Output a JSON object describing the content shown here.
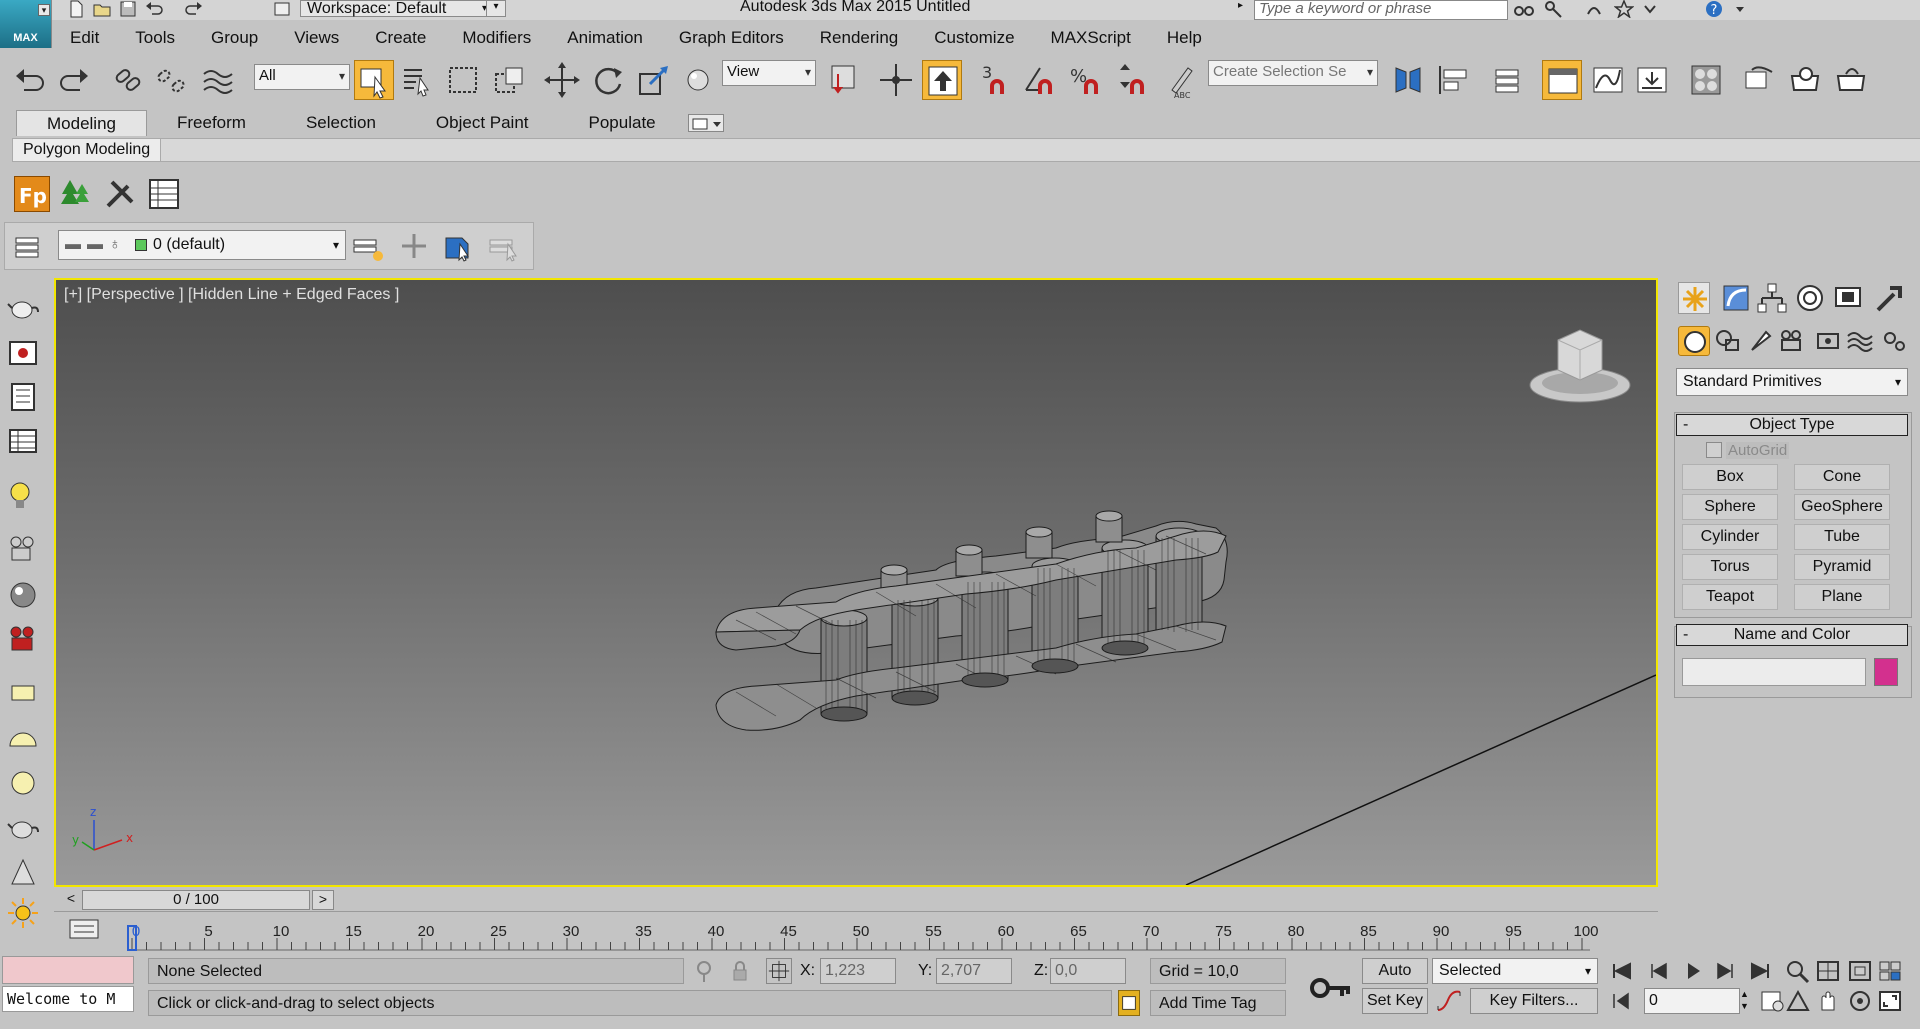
{
  "title_bar": {
    "workspace_label": "Workspace: Default",
    "app_title": "Autodesk 3ds Max  2015     Untitled",
    "search_placeholder": "Type a keyword or phrase",
    "logo_text": "MAX"
  },
  "menu": [
    "Edit",
    "Tools",
    "Group",
    "Views",
    "Create",
    "Modifiers",
    "Animation",
    "Graph Editors",
    "Rendering",
    "Customize",
    "MAXScript",
    "Help"
  ],
  "main_toolbar": {
    "selection_filter": "All",
    "ref_coord": "View",
    "snap_label": "3",
    "named_selection_placeholder": "Create Selection Se"
  },
  "ribbon": {
    "tabs": [
      "Modeling",
      "Freeform",
      "Selection",
      "Object Paint",
      "Populate"
    ],
    "active_tab": "Modeling",
    "panel_label": "Polygon Modeling"
  },
  "layer_bar": {
    "current_layer": "0 (default)"
  },
  "viewport": {
    "label": "[+] [Perspective ] [Hidden Line + Edged Faces ]",
    "border_color": "#f2e600",
    "axis": {
      "x": "x",
      "y": "y",
      "z": "z"
    }
  },
  "command_panel": {
    "primitive_type": "Standard Primitives",
    "object_type_title": "Object Type",
    "autogrid": "AutoGrid",
    "primitives": [
      "Box",
      "Cone",
      "Sphere",
      "GeoSphere",
      "Cylinder",
      "Tube",
      "Torus",
      "Pyramid",
      "Teapot",
      "Plane"
    ],
    "name_color_title": "Name and Color",
    "object_color": "#d3308e"
  },
  "time_slider": {
    "position": "0 / 100",
    "prev": "<",
    "next": ">"
  },
  "track_bar": {
    "ticks": [
      "0",
      "5",
      "10",
      "15",
      "20",
      "25",
      "30",
      "35",
      "40",
      "45",
      "50",
      "55",
      "60",
      "65",
      "70",
      "75",
      "80",
      "85",
      "90",
      "95",
      "100"
    ]
  },
  "status_bar": {
    "maxscript_listener": "Welcome to M",
    "selection_status": "None Selected",
    "prompt": "Click or click-and-drag to select objects",
    "x_label": "X:",
    "x_value": "1,223",
    "y_label": "Y:",
    "y_value": "2,707",
    "z_label": "Z:",
    "z_value": "0,0",
    "grid": "Grid = 10,0",
    "add_time_tag": "Add Time Tag",
    "auto_key": "Auto Key",
    "set_key": "Set Key",
    "key_mode": "Selected",
    "key_filters": "Key Filters...",
    "current_frame": "0"
  }
}
